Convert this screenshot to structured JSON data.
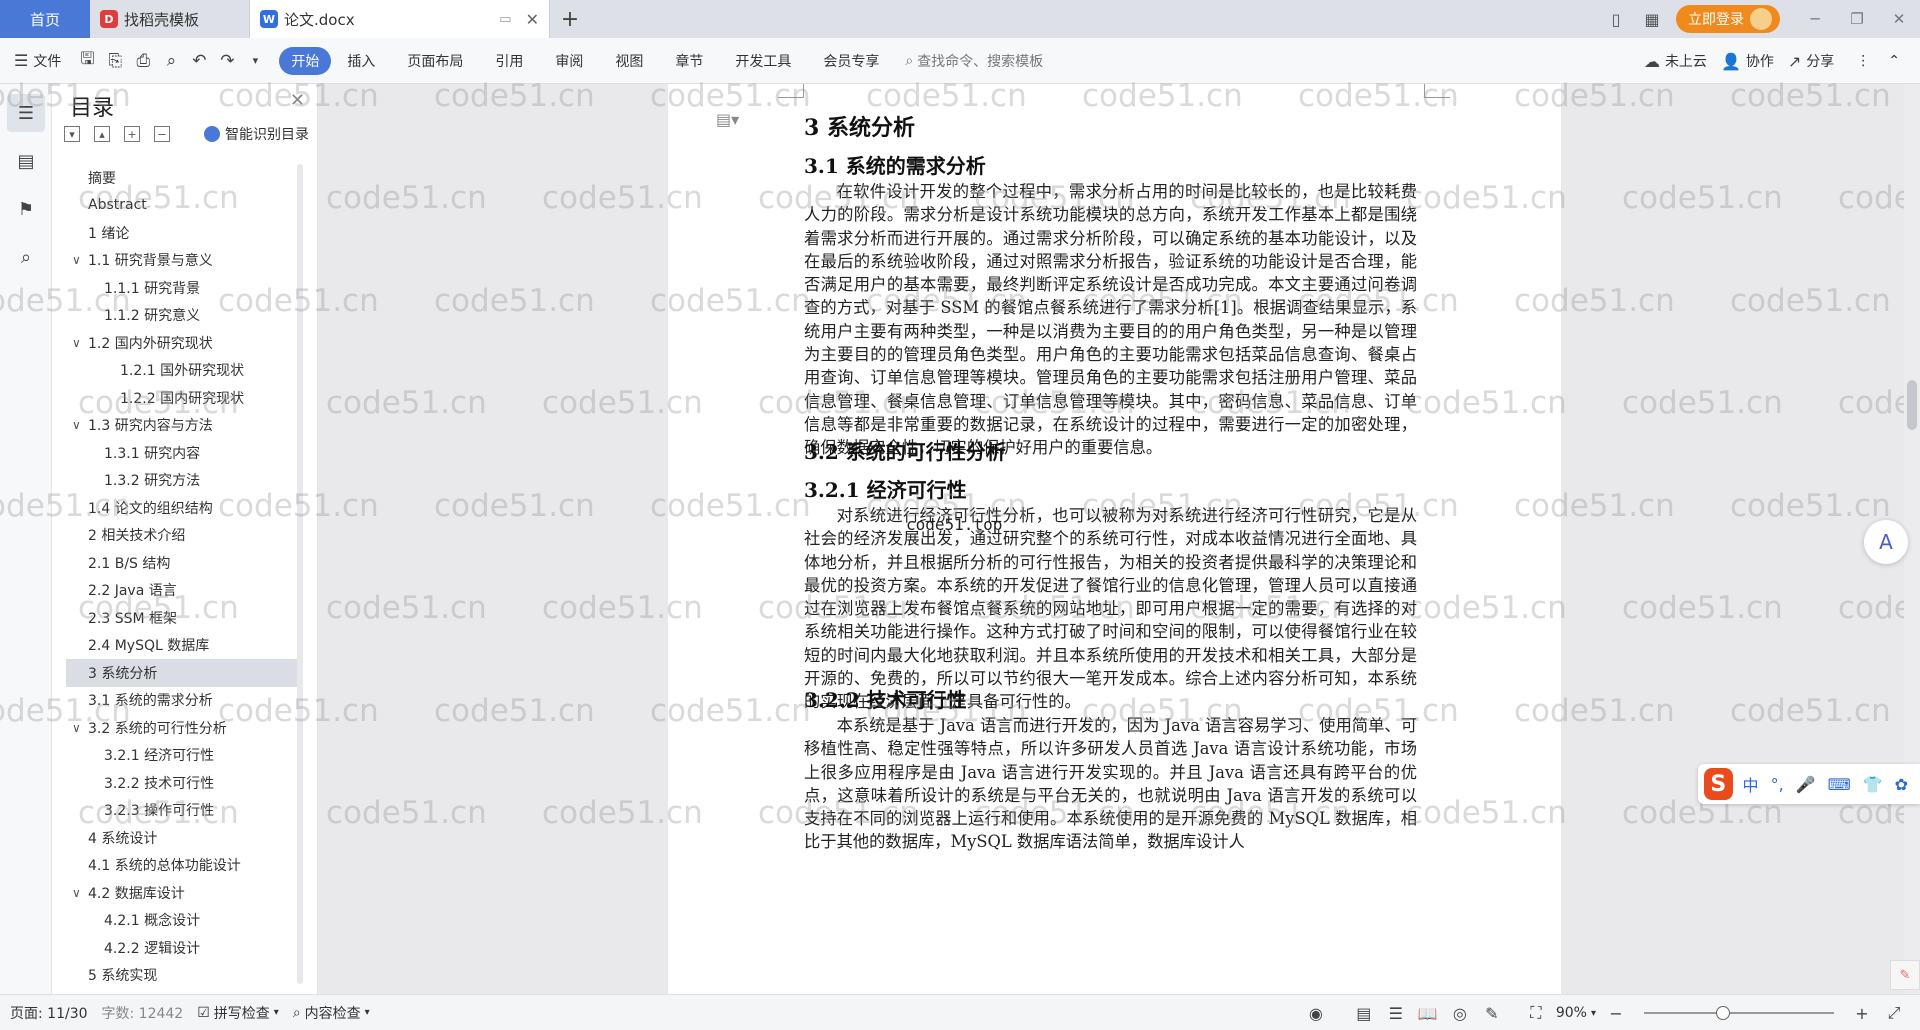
{
  "tabs": {
    "home": "首页",
    "items": [
      {
        "label": "找稻壳模板",
        "icon": "daoke-icon",
        "color": "#e03c3c"
      },
      {
        "label": "论文.docx",
        "icon": "wps-writer-icon",
        "color": "#2f6fe0"
      }
    ]
  },
  "window": {
    "login_label": "立即登录"
  },
  "ribbon": {
    "file_label": "文件",
    "tabs": [
      "开始",
      "插入",
      "页面布局",
      "引用",
      "审阅",
      "视图",
      "章节",
      "开发工具",
      "会员专享"
    ],
    "active_tab": "开始",
    "search_placeholder": "查找命令、搜索模板",
    "cloud_label": "未上云",
    "collab_label": "协作",
    "share_label": "分享"
  },
  "toc": {
    "title": "目录",
    "smart_label": "智能识别目录",
    "items": [
      {
        "label": "摘要",
        "level": 1,
        "arrow": false
      },
      {
        "label": "Abstract",
        "level": 1,
        "arrow": false
      },
      {
        "label": "1 绪论",
        "level": 1,
        "arrow": false
      },
      {
        "label": "1.1 研究背景与意义",
        "level": 1,
        "arrow": true
      },
      {
        "label": "1.1.1 研究背景",
        "level": 2,
        "arrow": false
      },
      {
        "label": "1.1.2 研究意义",
        "level": 2,
        "arrow": false
      },
      {
        "label": "1.2 国内外研究现状",
        "level": 1,
        "arrow": true
      },
      {
        "label": "1.2.1 国外研究现状",
        "level": 3,
        "arrow": false
      },
      {
        "label": "1.2.2 国内研究现状",
        "level": 3,
        "arrow": false
      },
      {
        "label": "1.3 研究内容与方法",
        "level": 1,
        "arrow": true
      },
      {
        "label": "1.3.1 研究内容",
        "level": 2,
        "arrow": false
      },
      {
        "label": "1.3.2 研究方法",
        "level": 2,
        "arrow": false
      },
      {
        "label": "1.4 论文的组织结构",
        "level": 1,
        "arrow": false
      },
      {
        "label": "2 相关技术介绍",
        "level": 1,
        "arrow": false
      },
      {
        "label": "2.1 B/S 结构",
        "level": 1,
        "arrow": false
      },
      {
        "label": "2.2 Java 语言",
        "level": 1,
        "arrow": false
      },
      {
        "label": "2.3 SSM 框架",
        "level": 1,
        "arrow": false
      },
      {
        "label": "2.4 MySQL 数据库",
        "level": 1,
        "arrow": false
      },
      {
        "label": "3 系统分析",
        "level": 1,
        "arrow": false,
        "selected": true
      },
      {
        "label": "3.1 系统的需求分析",
        "level": 1,
        "arrow": false
      },
      {
        "label": "3.2 系统的可行性分析",
        "level": 1,
        "arrow": true
      },
      {
        "label": "3.2.1 经济可行性",
        "level": 2,
        "arrow": false
      },
      {
        "label": "3.2.2 技术可行性",
        "level": 2,
        "arrow": false
      },
      {
        "label": "3.2.3 操作可行性",
        "level": 2,
        "arrow": false
      },
      {
        "label": "4 系统设计",
        "level": 1,
        "arrow": false
      },
      {
        "label": "4.1 系统的总体功能设计",
        "level": 1,
        "arrow": false
      },
      {
        "label": "4.2 数据库设计",
        "level": 1,
        "arrow": true
      },
      {
        "label": "4.2.1 概念设计",
        "level": 2,
        "arrow": false
      },
      {
        "label": "4.2.2 逻辑设计",
        "level": 2,
        "arrow": false
      },
      {
        "label": "5 系统实现",
        "level": 1,
        "arrow": false
      }
    ]
  },
  "document": {
    "h1": "3 系统分析",
    "h2_1": "3.1 系统的需求分析",
    "p1": "在软件设计开发的整个过程中，需求分析占用的时间是比较长的，也是比较耗费人力的阶段。需求分析是设计系统功能模块的总方向，系统开发工作基本上都是围绕着需求分析而进行开展的。通过需求分析阶段，可以确定系统的基本功能设计，以及在最后的系统验收阶段，通过对照需求分析报告，验证系统的功能设计是否合理，能否满足用户的基本需要，最终判断评定系统设计是否成功完成。本文主要通过问卷调查的方式，对基于 SSM 的餐馆点餐系统进行了需求分析[1]。根据调查结果显示，系统用户主要有两种类型，一种是以消费为主要目的的用户角色类型，另一种是以管理为主要目的的管理员角色类型。用户角色的主要功能需求包括菜品信息查询、餐桌占用查询、订单信息管理等模块。管理员角色的主要功能需求包括注册用户管理、菜品信息管理、餐桌信息管理、订单信息管理等模块。其中，密码信息、菜品信息、订单信息等都是非常重要的数据记录，在系统设计的过程中，需要进行一定的加密处理，确保数据安全性，切实的保护好用户的重要信息。",
    "h2_2": "3.2 系统的可行性分析",
    "note": "code51.top",
    "h3_1": "3.2.1 经济可行性",
    "p2": "对系统进行经济可行性分析，也可以被称为对系统进行经济可行性研究，它是从社会的经济发展出发，通过研究整个的系统可行性，对成本收益情况进行全面地、具体地分析，并且根据所分析的可行性报告，为相关的投资者提供最科学的决策理论和最优的投资方案。本系统的开发促进了餐馆行业的信息化管理，管理人员可以直接通过在浏览器上发布餐馆点餐系统的网站地址，即可用户根据一定的需要，有选择的对系统相关功能进行操作。这种方式打破了时间和空间的限制，可以使得餐馆行业在较短的时间内最大化地获取利润。并且本系统所使用的开发技术和相关工具，大部分是开源的、免费的，所以可以节约很大一笔开发成本。综合上述内容分析可知，本系统的实现在经济层面上是具备可行性的。",
    "h3_2": "3.2.2 技术可行性",
    "p3": "本系统是基于 Java 语言而进行开发的，因为 Java 语言容易学习、使用简单、可移植性高、稳定性强等特点，所以许多研发人员首选 Java 语言设计系统功能，市场上很多应用程序是由 Java 语言进行开发实现的。并且 Java 语言还具有跨平台的优点，这意味着所设计的系统是与平台无关的，也就说明由 Java 语言开发的系统可以支持在不同的浏览器上运行和使用。本系统使用的是开源免费的 MySQL 数据库，相比于其他的数据库，MySQL 数据库语法简单，数据库设计人"
  },
  "watermark": "code51.cn",
  "ime": {
    "lang": "中"
  },
  "status": {
    "page": "页面: 11/30",
    "words": "字数: 12442",
    "spell": "拼写检查",
    "content_check": "内容检查",
    "zoom": "90%"
  },
  "colors": {
    "accent": "#4a78d6",
    "login": "#f08a1c"
  }
}
